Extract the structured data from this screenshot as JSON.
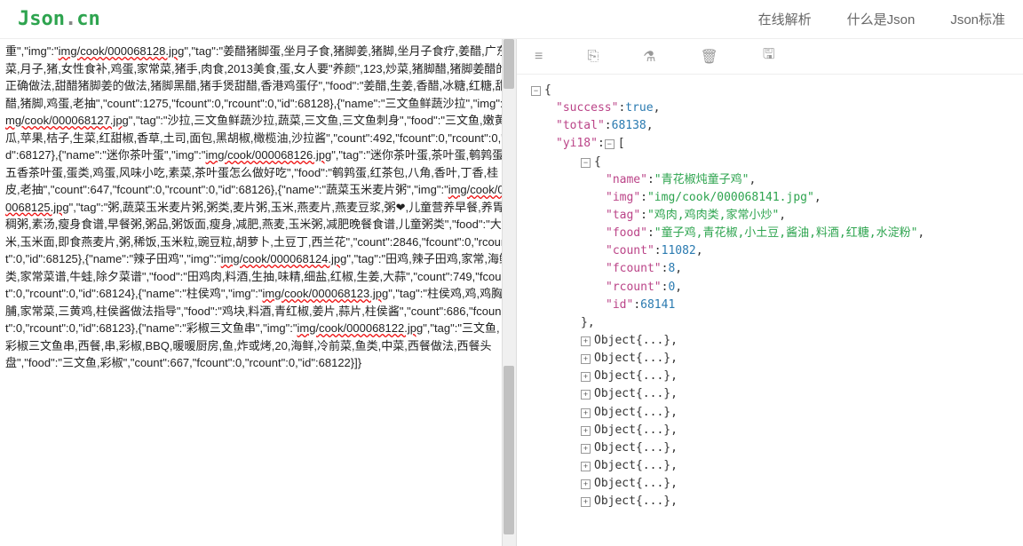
{
  "site": {
    "logo_j": "Json",
    "logo_dot": ".",
    "logo_cn": "cn"
  },
  "nav": {
    "parse": "在线解析",
    "whatis": "什么是Json",
    "std": "Json标准"
  },
  "toolbar": {
    "db": "≡",
    "file": "⎘",
    "flask": "⚗",
    "trash": "🗑",
    "save": "🖫"
  },
  "raw_json": "重\",\"img\":\"img/cook/000068128.jpg\",\"tag\":\"姜醋猪脚蛋,坐月子食,猪脚姜,猪脚,坐月子食疗,姜醋,广东菜,月子,猪,女性食补,鸡蛋,家常菜,猪手,肉食,2013美食,蛋,女人要\"养颜\",123,炒菜,猪脚醋,猪脚姜醋的正确做法,甜醋猪脚姜的做法,猪脚黑醋,猪手煲甜醋,香港鸡蛋仔\",\"food\":\"姜醋,生姜,香醋,冰糖,红糖,甜醋,猪脚,鸡蛋,老抽\",\"count\":1275,\"fcount\":0,\"rcount\":0,\"id\":68128},{\"name\":\"三文鱼鲜蔬沙拉\",\"img\":\"img/cook/000068127.jpg\",\"tag\":\"沙拉,三文鱼鲜蔬沙拉,蔬菜,三文鱼,三文鱼刺身\",\"food\":\"三文鱼,嫩黄瓜,苹果,桔子,生菜,红甜椒,香草,土司,面包,黑胡椒,橄榄油,沙拉酱\",\"count\":492,\"fcount\":0,\"rcount\":0,\"id\":68127},{\"name\":\"迷你茶叶蛋\",\"img\":\"img/cook/000068126.jpg\",\"tag\":\"迷你茶叶蛋,茶叶蛋,鹌鹑蛋,五香茶叶蛋,蛋类,鸡蛋,风味小吃,素菜,茶叶蛋怎么做好吃\",\"food\":\"鹌鹑蛋,红茶包,八角,香叶,丁香,桂皮,老抽\",\"count\":647,\"fcount\":0,\"rcount\":0,\"id\":68126},{\"name\":\"蔬菜玉米麦片粥\",\"img\":\"img/cook/000068125.jpg\",\"tag\":\"粥,蔬菜玉米麦片粥,粥类,麦片粥,玉米,燕麦片,燕麦豆浆,粥❤,儿童营养早餐,养胃稠粥,素汤,瘦身食谱,早餐粥,粥品,粥饭面,瘦身,减肥,燕麦,玉米粥,减肥晚餐食谱,儿童粥类\",\"food\":\"大米,玉米面,即食燕麦片,粥,稀饭,玉米粒,豌豆粒,胡萝卜,土豆丁,西兰花\",\"count\":2846,\"fcount\":0,\"rcount\":0,\"id\":68125},{\"name\":\"辣子田鸡\",\"img\":\"img/cook/000068124.jpg\",\"tag\":\"田鸡,辣子田鸡,家常,海鲜类,家常菜谱,牛蛙,除夕菜谱\",\"food\":\"田鸡肉,料酒,生抽,味精,细盐,红椒,生姜,大蒜\",\"count\":749,\"fcount\":0,\"rcount\":0,\"id\":68124},{\"name\":\"柱侯鸡\",\"img\":\"img/cook/000068123.jpg\",\"tag\":\"柱侯鸡,鸡,鸡胸脯,家常菜,三黄鸡,柱侯酱做法指导\",\"food\":\"鸡块,料酒,青红椒,姜片,蒜片,柱侯酱\",\"count\":686,\"fcount\":0,\"rcount\":0,\"id\":68123},{\"name\":\"彩椒三文鱼串\",\"img\":\"img/cook/000068122.jpg\",\"tag\":\"三文鱼,彩椒三文鱼串,西餐,串,彩椒,BBQ,暖暖厨房,鱼,炸或烤,20,海鲜,冷前菜,鱼类,中菜,西餐做法,西餐头盘\",\"food\":\"三文鱼,彩椒\",\"count\":667,\"fcount\":0,\"rcount\":0,\"id\":68122}]}",
  "tree": {
    "success": true,
    "total": 68138,
    "yi18_key": "yi18",
    "item0": {
      "name_key": "name",
      "name_val": "青花椒炖童子鸡",
      "img_key": "img",
      "img_val": "img/cook/000068141.jpg",
      "tag_key": "tag",
      "tag_val": "鸡肉,鸡肉类,家常小炒",
      "food_key": "food",
      "food_val": "童子鸡,青花椒,小土豆,酱油,料酒,红糖,水淀粉",
      "count_key": "count",
      "count_val": 11082,
      "fcount_key": "fcount",
      "fcount_val": 8,
      "rcount_key": "rcount",
      "rcount_val": 0,
      "id_key": "id",
      "id_val": 68141
    },
    "collapsed": [
      "Object{...}",
      "Object{...}",
      "Object{...}",
      "Object{...}",
      "Object{...}",
      "Object{...}",
      "Object{...}",
      "Object{...}",
      "Object{...}",
      "Object{...}"
    ]
  }
}
